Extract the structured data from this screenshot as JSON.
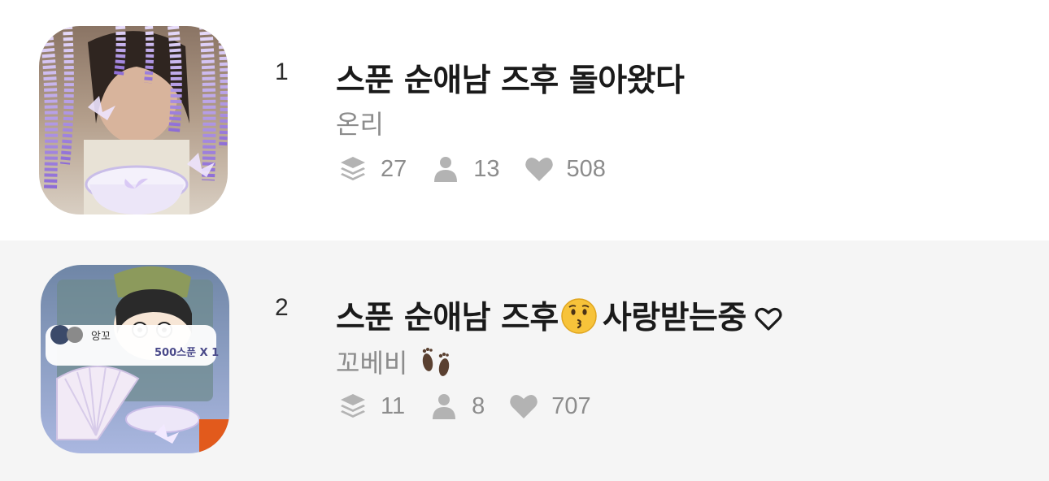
{
  "items": [
    {
      "rank": "1",
      "title": "스푼 순애남 즈후 돌아왔다",
      "author": "온리",
      "stats": {
        "episodes": "27",
        "subscribers": "13",
        "likes": "508"
      }
    },
    {
      "rank": "2",
      "title_before": "스푼 순애남 즈후",
      "title_after": "사랑받는중",
      "author": "꼬베비",
      "thumb_label_user": "앙꼬",
      "thumb_label_gift": "500스푼 X 1",
      "stats": {
        "episodes": "11",
        "subscribers": "8",
        "likes": "707"
      }
    }
  ],
  "icons": {
    "episodes": "layers-icon",
    "subscribers": "person-icon",
    "likes": "heart-icon",
    "title_emoji": "kissing-face-emoji",
    "title_heart": "outline-heart-icon",
    "author_emoji": "footprints-emoji"
  },
  "colors": {
    "title": "#1a1a1a",
    "meta": "#8c8c8c",
    "icon": "#b3b3b3",
    "row_alt_bg": "#f5f5f5"
  }
}
